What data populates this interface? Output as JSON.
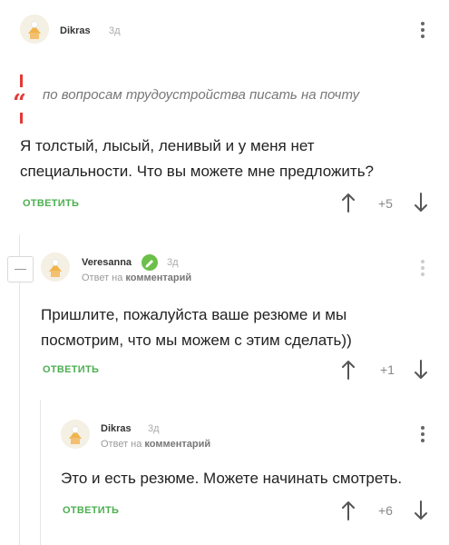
{
  "comments": [
    {
      "author": "Dikras",
      "time": "3д",
      "quote": "по вопросам трудоустройства писать на почту",
      "text_lines": [
        "Я толстый, лысый, ленивый и у меня нет",
        "специальности. Что вы можете мне предложить?"
      ],
      "reply_label": "ОТВЕТИТЬ",
      "score": "+5"
    },
    {
      "author": "Veresanna",
      "time": "3д",
      "meta_prefix": "Ответ на ",
      "meta_link": "комментарий",
      "text_lines": [
        "Пришлите, пожалуйста ваше резюме и мы",
        "посмотрим, что мы можем с этим сделать))"
      ],
      "reply_label": "ОТВЕТИТЬ",
      "score": "+1"
    },
    {
      "author": "Dikras",
      "time": "3д",
      "meta_prefix": "Ответ на ",
      "meta_link": "комментарий",
      "text_lines": [
        "Это и есть резюме. Можете начинать смотреть."
      ],
      "reply_label": "ОТВЕТИТЬ",
      "score": "+6"
    }
  ],
  "colors": {
    "accent": "#4caf50",
    "quote": "#e53935",
    "badge": "#6cc04a"
  }
}
